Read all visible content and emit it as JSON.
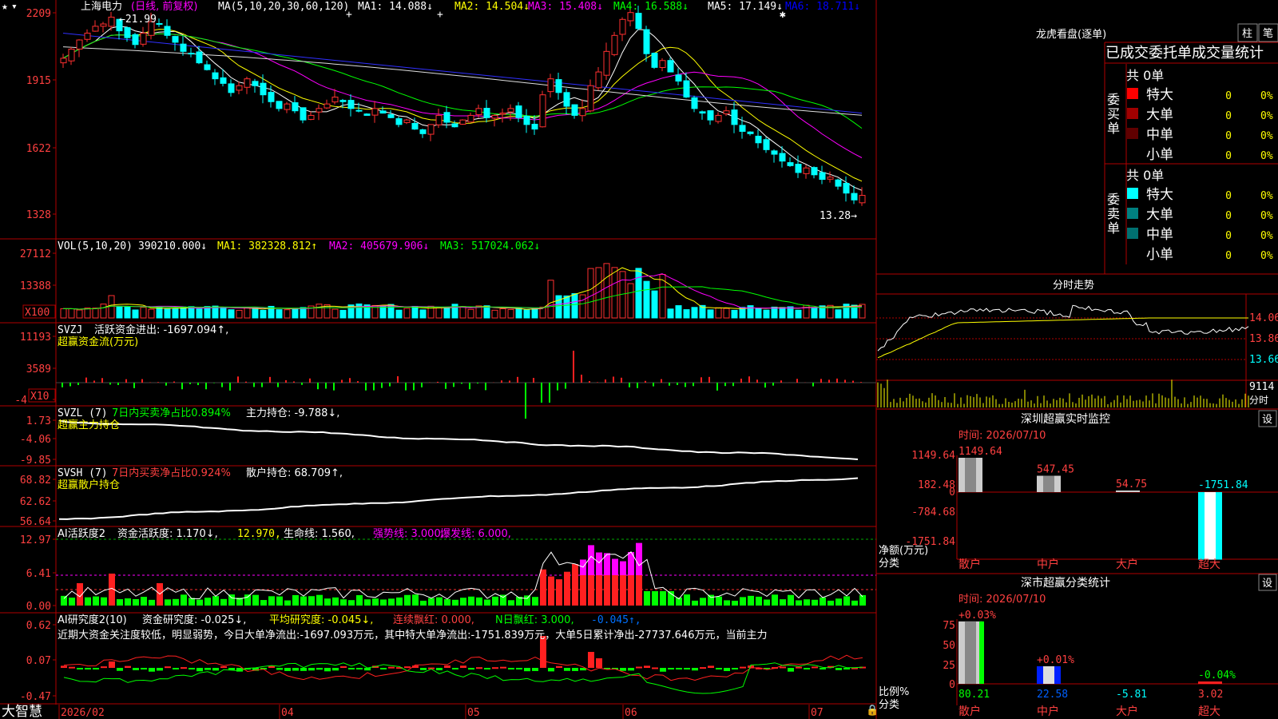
{
  "stock": {
    "name": "上海电力",
    "period_info": "(日线, 前复权)"
  },
  "price_panel": {
    "ma_label": "MA(5,10,20,30,60,120)",
    "ma_values": [
      {
        "label": "MA1: 14.088↓",
        "color": "#ffffff"
      },
      {
        "label": "MA2: 14.504↓",
        "color": "#ffff00"
      },
      {
        "label": "MA3: 15.408↓",
        "color": "#ff00ff"
      },
      {
        "label": "MA4: 16.588↓",
        "color": "#00ff00"
      },
      {
        "label": "MA5: 17.149↓",
        "color": "#ffffff"
      },
      {
        "label": "MA6: 18.711↓",
        "color": "#0000ff"
      }
    ],
    "y_ticks": [
      "2209",
      "1915",
      "1622",
      "1328"
    ],
    "max_label": "←21.99",
    "min_label": "13.28→"
  },
  "vol_panel": {
    "label": "VOL(5,10,20)",
    "value": "390210.000↓",
    "ma1": "MA1: 382328.812↑",
    "ma2": "MA2: 405679.906↓",
    "ma3": "MA3: 517024.062↓",
    "y_ticks": [
      "27112",
      "13388"
    ],
    "unit": "X100"
  },
  "svzj_panel": {
    "label": "SVZJ",
    "text": "活跃资金进出: -1697.094↑,",
    "sub": "超赢资金流(万元)",
    "y_ticks": [
      "11193",
      "3589",
      "-4"
    ],
    "unit": "X10"
  },
  "svzl_panel": {
    "label": "SVZL (7)",
    "text1": "7日内买卖净占比0.894%",
    "text2": "主力持仓: -9.788↓,",
    "sub": "超赢主力持仓",
    "y_ticks": [
      "1.73",
      "-4.06",
      "-9.85"
    ]
  },
  "svsh_panel": {
    "label": "SVSH (7)",
    "text1": "7日内买卖净占比0.924%",
    "text2": "散户持仓: 68.709↑,",
    "sub": "超赢散户持仓",
    "y_ticks": [
      "68.82",
      "62.62",
      "56.64"
    ]
  },
  "ai_active_panel": {
    "label": "AI活跃度2",
    "text1": "资金活跃度: 1.170↓,",
    "text2": "12.970,",
    "text3": "生命线: 1.560,",
    "text4": "强势线: 3.000,",
    "text5": "爆发线: 6.000,",
    "y_ticks": [
      "12.97",
      "6.41",
      "0.00"
    ]
  },
  "ai_research_panel": {
    "label": "AI研究度2(10)",
    "text1": "资金研究度: -0.025↓,",
    "text2": "平均研究度: -0.045↓,",
    "text3": "连续飘红: 0.000,",
    "text4": "N日飘红: 3.000,",
    "text5": "-0.045↑,",
    "desc": "近期大资金关注度较低，明显弱势，今日大单净流出:-1697.093万元，其中特大单净流出:-1751.839万元，大单5日累计净出-27737.646万元，当前主力",
    "y_ticks": [
      "0.62",
      "0.07",
      "-0.47"
    ]
  },
  "date_axis": {
    "labels": [
      "2026/02",
      "04",
      "05",
      "06",
      "07"
    ]
  },
  "brand": "大智慧",
  "right": {
    "lhb_title": "龙虎看盘(逐单)",
    "btn_zhu": "柱",
    "btn_bi": "笔",
    "order_header": "已成交委托单成交量统计",
    "buy": {
      "side": "委买单",
      "total": "共 0单",
      "rows": [
        {
          "label": "特大",
          "count": "0",
          "pct": "0%",
          "color": "#ff0000"
        },
        {
          "label": "大单",
          "count": "0",
          "pct": "0%",
          "color": "#a00000"
        },
        {
          "label": "中单",
          "count": "0",
          "pct": "0%",
          "color": "#600000"
        },
        {
          "label": "小单",
          "count": "0",
          "pct": "0%",
          "color": "#000000"
        }
      ]
    },
    "sell": {
      "side": "委卖单",
      "total": "共 0单",
      "rows": [
        {
          "label": "特大",
          "count": "0",
          "pct": "0%",
          "color": "#00ffff"
        },
        {
          "label": "大单",
          "count": "0",
          "pct": "0%",
          "color": "#008080"
        },
        {
          "label": "中单",
          "count": "0",
          "pct": "0%",
          "color": "#007070"
        },
        {
          "label": "小单",
          "count": "0",
          "pct": "0%",
          "color": "#000000"
        }
      ]
    },
    "intraday_title": "分时走势",
    "intraday_ticks": [
      "14.06",
      "13.86",
      "13.66"
    ],
    "intraday_vol": "9114",
    "intraday_unit": "分时",
    "monitor": {
      "title": "深圳超赢实时监控",
      "set_btn": "设",
      "time": "时间: 2026/07/10",
      "y_ticks": [
        "1149.64",
        "182.48",
        "0",
        "-784.68",
        "-1751.84"
      ],
      "y_unit": "净额(万元)",
      "x_unit": "分类",
      "chart_data": {
        "type": "bar",
        "categories": [
          "散户",
          "中户",
          "大户",
          "超大"
        ],
        "values": [
          1149.64,
          547.45,
          54.75,
          -1751.84
        ],
        "value_labels": [
          "1149.64",
          "547.45",
          "54.75",
          "-1751.84"
        ],
        "colors": [
          "#ffffff",
          "#ffffff",
          "#ff0000",
          "#00ffff"
        ]
      }
    },
    "classify": {
      "title": "深市超赢分类统计",
      "set_btn": "设",
      "time": "时间: 2026/07/10",
      "y_ticks": [
        "75",
        "50",
        "25",
        "0"
      ],
      "y_unit": "比例%",
      "x_unit": "分类",
      "chart_data": {
        "type": "bar",
        "categories": [
          "散户",
          "中户",
          "大户",
          "超大"
        ],
        "values": [
          80.21,
          22.58,
          -5.81,
          3.02
        ],
        "value_labels": [
          "80.21",
          "22.58",
          "-5.81",
          "3.02"
        ],
        "pct_labels": [
          "+0.03%",
          "+0.01%",
          "",
          "-0.04%"
        ]
      }
    }
  }
}
